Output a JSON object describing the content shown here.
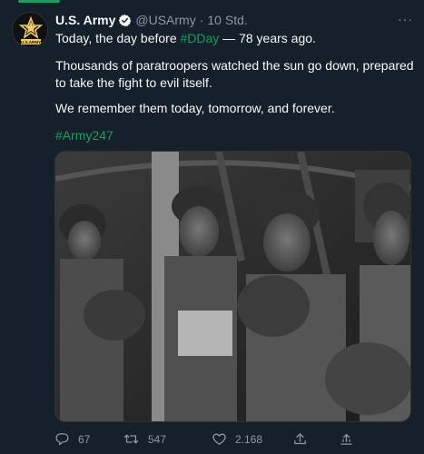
{
  "tweet": {
    "author_name": "U.S. Army",
    "handle": "@USArmy",
    "separator": "·",
    "time": "10 Std.",
    "more": "···",
    "avatar_text": "U.S.ARMY",
    "line1_prefix": "Today, the day before ",
    "line1_hashtag": "#DDay",
    "line1_suffix": " — 78 years ago.",
    "paragraph2": "Thousands of paratroopers watched the sun go down, prepared to take the fight to evil itself.",
    "paragraph3": "We remember them today, tomorrow, and forever.",
    "hashtag2": "#Army247",
    "media_alt": "Black and white photo of paratroopers with blackened faces inside an aircraft",
    "colors": {
      "accent": "#1d9b5f",
      "background": "#15202b",
      "muted": "#8b98a5",
      "verified": "#1d9bf0"
    }
  },
  "actions": {
    "replies": "67",
    "retweets": "547",
    "likes": "2.168",
    "reply_icon": "reply-icon",
    "retweet_icon": "retweet-icon",
    "like_icon": "heart-icon",
    "share_icon": "share-icon",
    "upload_icon": "upload-icon"
  }
}
